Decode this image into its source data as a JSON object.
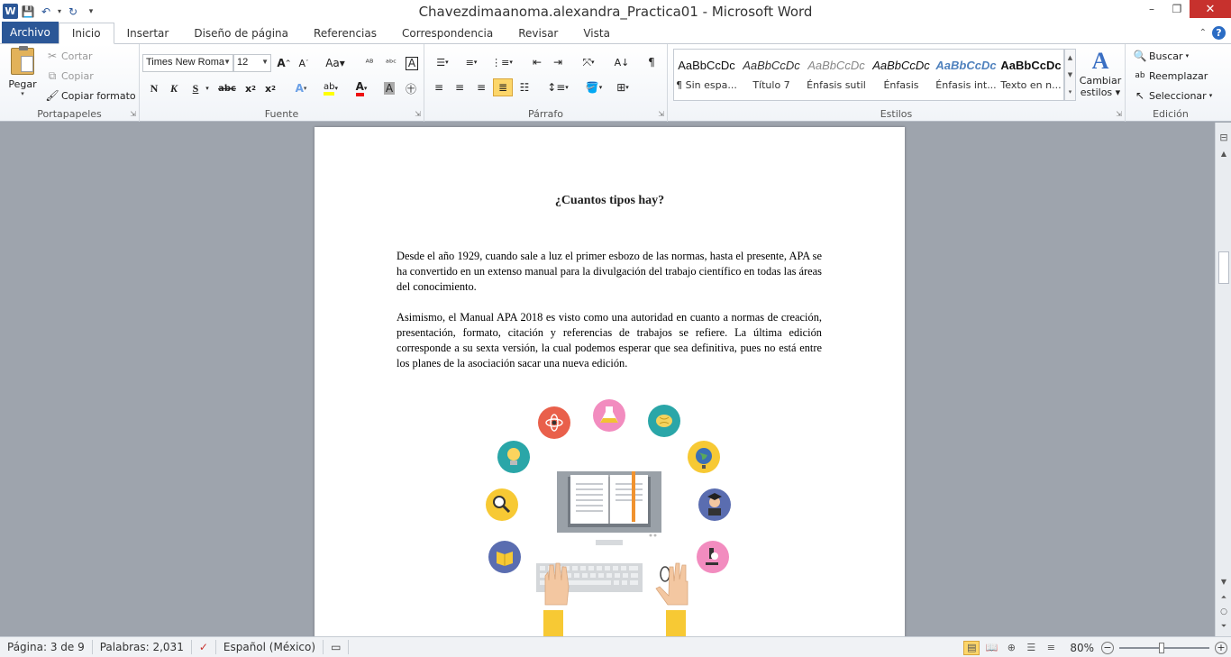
{
  "window": {
    "title": "Chavezdimaanoma.alexandra_Practica01  -  Microsoft Word",
    "logo": "W",
    "minimize": "–",
    "restore": "❐",
    "close": "✕"
  },
  "tabs": [
    {
      "label": "Archivo"
    },
    {
      "label": "Inicio"
    },
    {
      "label": "Insertar"
    },
    {
      "label": "Diseño de página"
    },
    {
      "label": "Referencias"
    },
    {
      "label": "Correspondencia"
    },
    {
      "label": "Revisar"
    },
    {
      "label": "Vista"
    }
  ],
  "clipboard": {
    "paste": "Pegar",
    "cut": "Cortar",
    "copy": "Copiar",
    "format_painter": "Copiar formato",
    "label": "Portapapeles"
  },
  "font": {
    "family": "Times New Roma",
    "size": "12",
    "label": "Fuente"
  },
  "paragraph": {
    "label": "Párrafo"
  },
  "styles": {
    "label": "Estilos",
    "items": [
      {
        "preview": "AaBbCcDc",
        "name": "¶ Sin espa..."
      },
      {
        "preview": "AaBbCcDc",
        "name": "Título 7"
      },
      {
        "preview": "AaBbCcDc",
        "name": "Énfasis sutil"
      },
      {
        "preview": "AaBbCcDc",
        "name": "Énfasis"
      },
      {
        "preview": "AaBbCcDc",
        "name": "Énfasis int..."
      },
      {
        "preview": "AaBbCcDc",
        "name": "Texto en n..."
      }
    ],
    "change": "Cambiar",
    "change2": "estilos"
  },
  "editing": {
    "find": "Buscar",
    "replace": "Reemplazar",
    "select": "Seleccionar",
    "label": "Edición"
  },
  "document": {
    "title": "¿Cuantos tipos hay?",
    "para1": "Desde el año 1929, cuando sale a luz el primer esbozo de las normas, hasta el presente, APA se ha convertido en un extenso manual para la divulgación del trabajo científico en todas las áreas del conocimiento.",
    "para2": "Asimismo, el Manual APA 2018 es visto como una autoridad en cuanto a normas de creación, presentación, formato, citación y referencias de trabajos se refiere. La última edición corresponde a su sexta versión, la cual podemos esperar que sea definitiva, pues no está entre los planes de la asociación sacar una nueva edición."
  },
  "status": {
    "page": "Página: 3 de 9",
    "words": "Palabras: 2,031",
    "language": "Español (México)",
    "zoom": "80%"
  }
}
